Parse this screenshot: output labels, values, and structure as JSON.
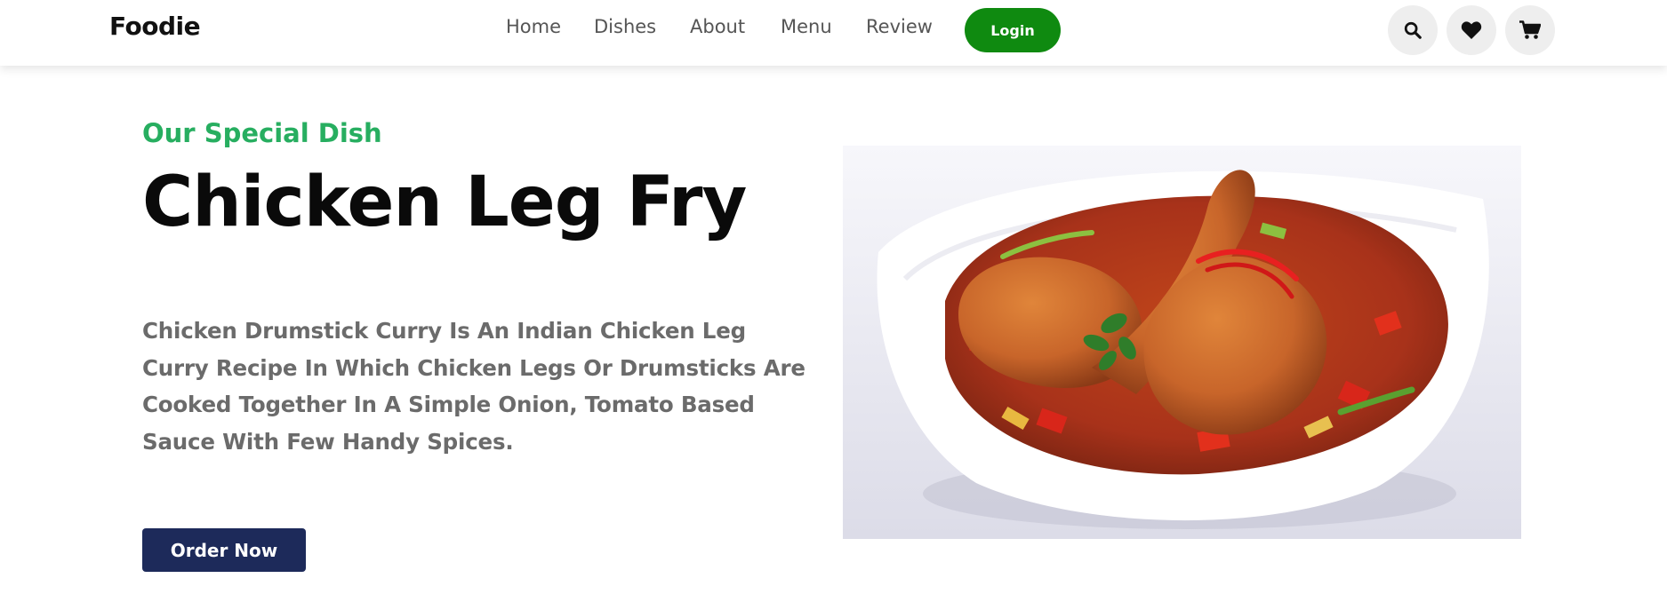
{
  "header": {
    "logo": "Foodie",
    "nav": {
      "home": "Home",
      "dishes": "Dishes",
      "about": "About",
      "menu": "Menu",
      "review": "Review"
    },
    "login_label": "Login",
    "icons": [
      "search-icon",
      "heart-icon",
      "cart-icon"
    ]
  },
  "hero": {
    "subtitle": "Our Special Dish",
    "title": "Chicken Leg Fry",
    "description": "Chicken Drumstick Curry Is An Indian Chicken Leg Curry Recipe In Which Chicken Legs Or Drumsticks Are Cooked Together In A Simple Onion, Tomato Based Sauce With Few Handy Spices.",
    "order_label": "Order Now"
  },
  "colors": {
    "accent_green": "#27ae60",
    "login_green": "#0f8a10",
    "order_navy": "#1d2a5a",
    "text_gray": "#6b6b6b"
  }
}
